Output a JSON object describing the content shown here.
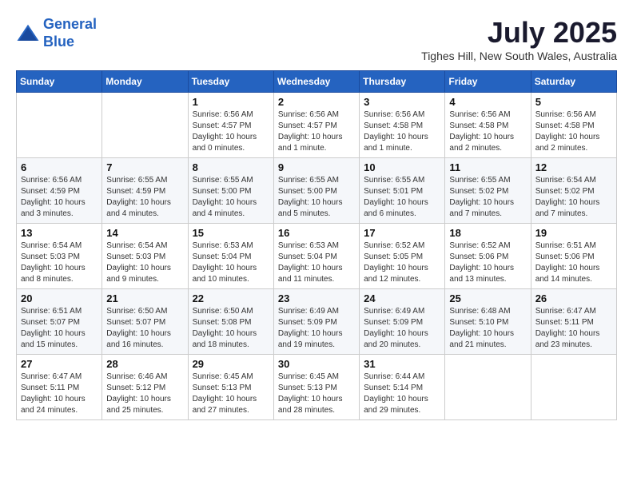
{
  "header": {
    "logo_line1": "General",
    "logo_line2": "Blue",
    "month_title": "July 2025",
    "location": "Tighes Hill, New South Wales, Australia"
  },
  "days_header": [
    "Sunday",
    "Monday",
    "Tuesday",
    "Wednesday",
    "Thursday",
    "Friday",
    "Saturday"
  ],
  "weeks": [
    [
      {
        "day": "",
        "info": ""
      },
      {
        "day": "",
        "info": ""
      },
      {
        "day": "1",
        "info": "Sunrise: 6:56 AM\nSunset: 4:57 PM\nDaylight: 10 hours and 0 minutes."
      },
      {
        "day": "2",
        "info": "Sunrise: 6:56 AM\nSunset: 4:57 PM\nDaylight: 10 hours and 1 minute."
      },
      {
        "day": "3",
        "info": "Sunrise: 6:56 AM\nSunset: 4:58 PM\nDaylight: 10 hours and 1 minute."
      },
      {
        "day": "4",
        "info": "Sunrise: 6:56 AM\nSunset: 4:58 PM\nDaylight: 10 hours and 2 minutes."
      },
      {
        "day": "5",
        "info": "Sunrise: 6:56 AM\nSunset: 4:58 PM\nDaylight: 10 hours and 2 minutes."
      }
    ],
    [
      {
        "day": "6",
        "info": "Sunrise: 6:56 AM\nSunset: 4:59 PM\nDaylight: 10 hours and 3 minutes."
      },
      {
        "day": "7",
        "info": "Sunrise: 6:55 AM\nSunset: 4:59 PM\nDaylight: 10 hours and 4 minutes."
      },
      {
        "day": "8",
        "info": "Sunrise: 6:55 AM\nSunset: 5:00 PM\nDaylight: 10 hours and 4 minutes."
      },
      {
        "day": "9",
        "info": "Sunrise: 6:55 AM\nSunset: 5:00 PM\nDaylight: 10 hours and 5 minutes."
      },
      {
        "day": "10",
        "info": "Sunrise: 6:55 AM\nSunset: 5:01 PM\nDaylight: 10 hours and 6 minutes."
      },
      {
        "day": "11",
        "info": "Sunrise: 6:55 AM\nSunset: 5:02 PM\nDaylight: 10 hours and 7 minutes."
      },
      {
        "day": "12",
        "info": "Sunrise: 6:54 AM\nSunset: 5:02 PM\nDaylight: 10 hours and 7 minutes."
      }
    ],
    [
      {
        "day": "13",
        "info": "Sunrise: 6:54 AM\nSunset: 5:03 PM\nDaylight: 10 hours and 8 minutes."
      },
      {
        "day": "14",
        "info": "Sunrise: 6:54 AM\nSunset: 5:03 PM\nDaylight: 10 hours and 9 minutes."
      },
      {
        "day": "15",
        "info": "Sunrise: 6:53 AM\nSunset: 5:04 PM\nDaylight: 10 hours and 10 minutes."
      },
      {
        "day": "16",
        "info": "Sunrise: 6:53 AM\nSunset: 5:04 PM\nDaylight: 10 hours and 11 minutes."
      },
      {
        "day": "17",
        "info": "Sunrise: 6:52 AM\nSunset: 5:05 PM\nDaylight: 10 hours and 12 minutes."
      },
      {
        "day": "18",
        "info": "Sunrise: 6:52 AM\nSunset: 5:06 PM\nDaylight: 10 hours and 13 minutes."
      },
      {
        "day": "19",
        "info": "Sunrise: 6:51 AM\nSunset: 5:06 PM\nDaylight: 10 hours and 14 minutes."
      }
    ],
    [
      {
        "day": "20",
        "info": "Sunrise: 6:51 AM\nSunset: 5:07 PM\nDaylight: 10 hours and 15 minutes."
      },
      {
        "day": "21",
        "info": "Sunrise: 6:50 AM\nSunset: 5:07 PM\nDaylight: 10 hours and 16 minutes."
      },
      {
        "day": "22",
        "info": "Sunrise: 6:50 AM\nSunset: 5:08 PM\nDaylight: 10 hours and 18 minutes."
      },
      {
        "day": "23",
        "info": "Sunrise: 6:49 AM\nSunset: 5:09 PM\nDaylight: 10 hours and 19 minutes."
      },
      {
        "day": "24",
        "info": "Sunrise: 6:49 AM\nSunset: 5:09 PM\nDaylight: 10 hours and 20 minutes."
      },
      {
        "day": "25",
        "info": "Sunrise: 6:48 AM\nSunset: 5:10 PM\nDaylight: 10 hours and 21 minutes."
      },
      {
        "day": "26",
        "info": "Sunrise: 6:47 AM\nSunset: 5:11 PM\nDaylight: 10 hours and 23 minutes."
      }
    ],
    [
      {
        "day": "27",
        "info": "Sunrise: 6:47 AM\nSunset: 5:11 PM\nDaylight: 10 hours and 24 minutes."
      },
      {
        "day": "28",
        "info": "Sunrise: 6:46 AM\nSunset: 5:12 PM\nDaylight: 10 hours and 25 minutes."
      },
      {
        "day": "29",
        "info": "Sunrise: 6:45 AM\nSunset: 5:13 PM\nDaylight: 10 hours and 27 minutes."
      },
      {
        "day": "30",
        "info": "Sunrise: 6:45 AM\nSunset: 5:13 PM\nDaylight: 10 hours and 28 minutes."
      },
      {
        "day": "31",
        "info": "Sunrise: 6:44 AM\nSunset: 5:14 PM\nDaylight: 10 hours and 29 minutes."
      },
      {
        "day": "",
        "info": ""
      },
      {
        "day": "",
        "info": ""
      }
    ]
  ]
}
